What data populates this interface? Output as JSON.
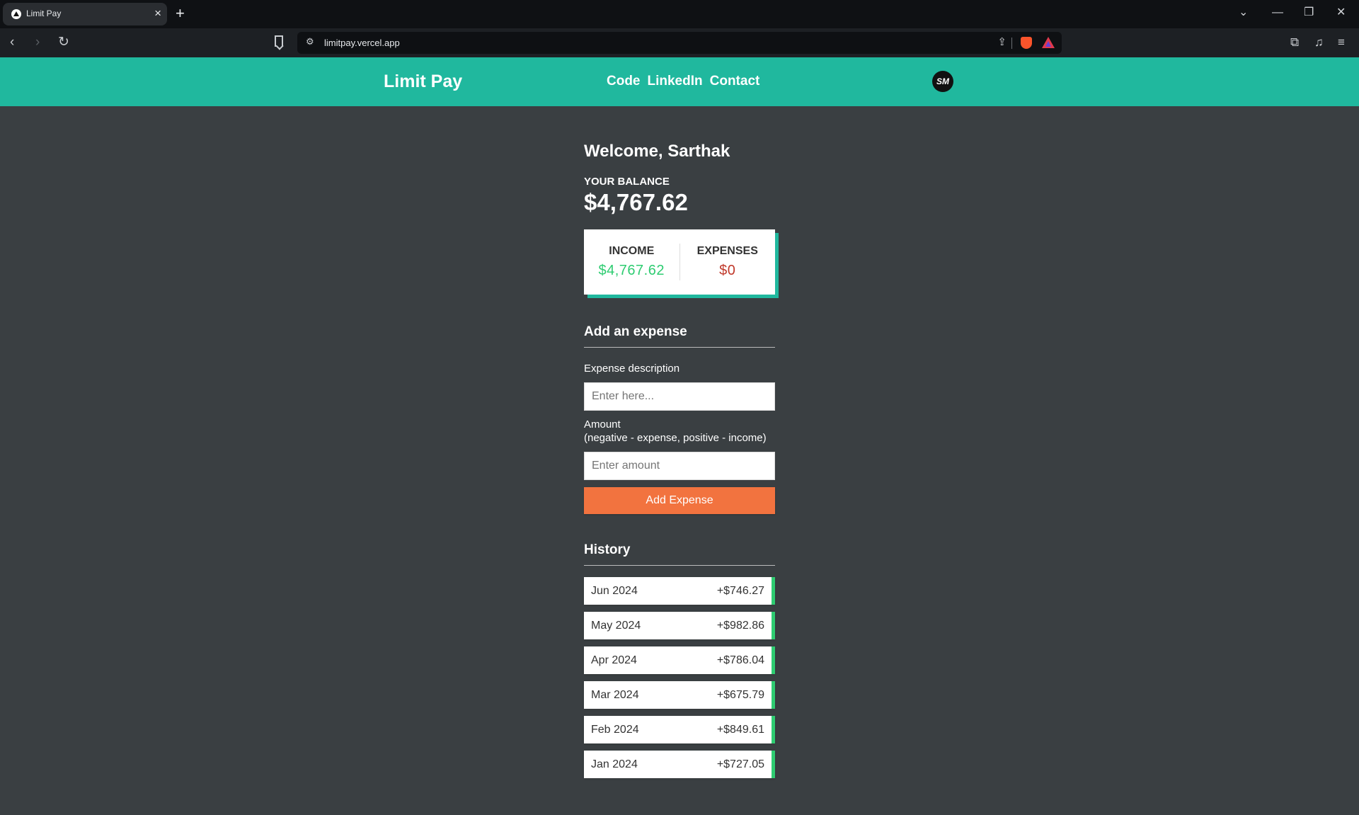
{
  "browser": {
    "tab_title": "Limit Pay",
    "url": "limitpay.vercel.app"
  },
  "header": {
    "brand": "Limit Pay",
    "nav": [
      "Code",
      "LinkedIn",
      "Contact"
    ],
    "logo_text": "SM"
  },
  "main": {
    "welcome": "Welcome, Sarthak",
    "balance_label": "YOUR BALANCE",
    "balance_value": "$4,767.62",
    "income_label": "INCOME",
    "income_value": "$4,767.62",
    "expenses_label": "EXPENSES",
    "expenses_value": "$0"
  },
  "form": {
    "heading": "Add an expense",
    "description_label": "Expense description",
    "description_placeholder": "Enter here...",
    "amount_label": "Amount",
    "amount_hint": "(negative - expense, positive - income)",
    "amount_placeholder": "Enter amount",
    "submit_label": "Add Expense"
  },
  "history": {
    "heading": "History",
    "items": [
      {
        "label": "Jun 2024",
        "amount": "+$746.27"
      },
      {
        "label": "May 2024",
        "amount": "+$982.86"
      },
      {
        "label": "Apr 2024",
        "amount": "+$786.04"
      },
      {
        "label": "Mar 2024",
        "amount": "+$675.79"
      },
      {
        "label": "Feb 2024",
        "amount": "+$849.61"
      },
      {
        "label": "Jan 2024",
        "amount": "+$727.05"
      }
    ]
  },
  "colors": {
    "header_bg": "#20b89e",
    "page_bg": "#3a3f42",
    "income": "#2ecc71",
    "expense": "#c0392b",
    "button": "#f2733f"
  }
}
